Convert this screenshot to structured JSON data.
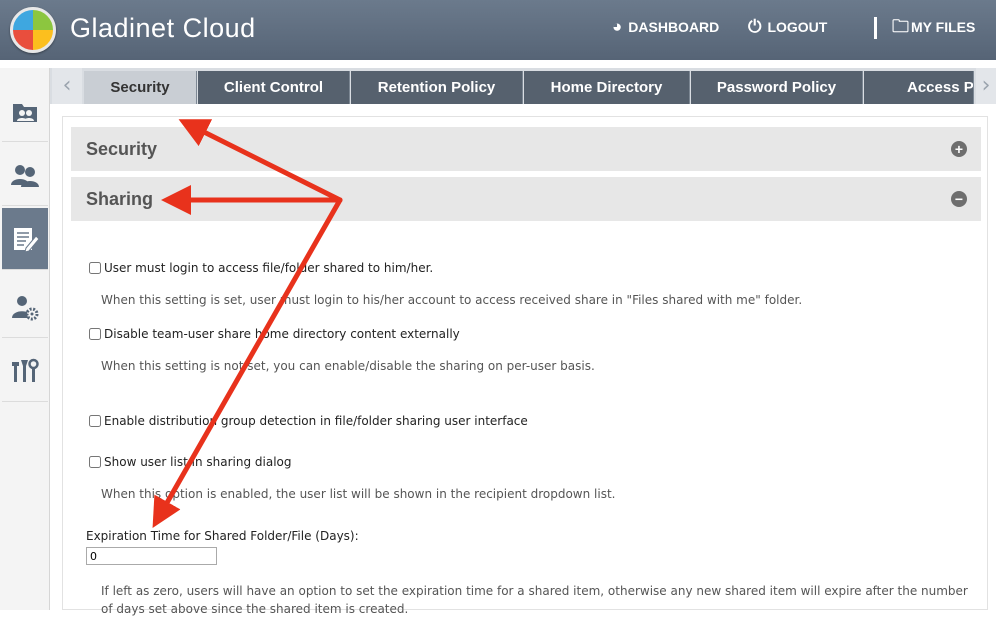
{
  "header": {
    "brand": "Gladinet Cloud",
    "nav": [
      {
        "icon": "dashboard-icon",
        "label": "DASHBOARD"
      },
      {
        "icon": "power-icon",
        "label": "LOGOUT"
      },
      {
        "icon": "folder-globe-icon",
        "label": "MY FILES"
      }
    ]
  },
  "sidebar": {
    "items": [
      {
        "icon": "users-folder-icon"
      },
      {
        "icon": "users-icon"
      },
      {
        "icon": "edit-document-icon",
        "active": true
      },
      {
        "icon": "user-settings-icon"
      },
      {
        "icon": "tools-icon"
      }
    ]
  },
  "tabs": [
    "Security",
    "Client Control",
    "Retention Policy",
    "Home Directory",
    "Password Policy",
    "Access P"
  ],
  "sections": {
    "security": {
      "title": "Security",
      "toggle": "+"
    },
    "sharing": {
      "title": "Sharing",
      "toggle": "−"
    }
  },
  "options": [
    {
      "label": "User must login to access file/folder shared to him/her.",
      "checked": false,
      "desc": "When this setting is set, user must login to his/her account to access received share in \"Files shared with me\" folder."
    },
    {
      "label": "Disable team-user share home directory content externally",
      "checked": false,
      "desc": "When this setting is not set, you can enable/disable the sharing on per-user basis."
    },
    {
      "label": "Enable distribution group detection in file/folder sharing user interface",
      "checked": false
    },
    {
      "label": "Show user list in sharing dialog",
      "checked": false,
      "desc": "When this option is enabled, the user list will be shown in the recipient dropdown list."
    }
  ],
  "expiration": {
    "label": "Expiration Time for Shared Folder/File (Days):",
    "value": "0",
    "desc": "If left as zero, users will have an option to set the expiration time for a shared item, otherwise any new shared item will expire after the number of days set above since the shared item is created."
  },
  "colors": {
    "header": "#5f6d7f",
    "tab": "#56616e",
    "annotation_arrow": "#e8321c"
  }
}
